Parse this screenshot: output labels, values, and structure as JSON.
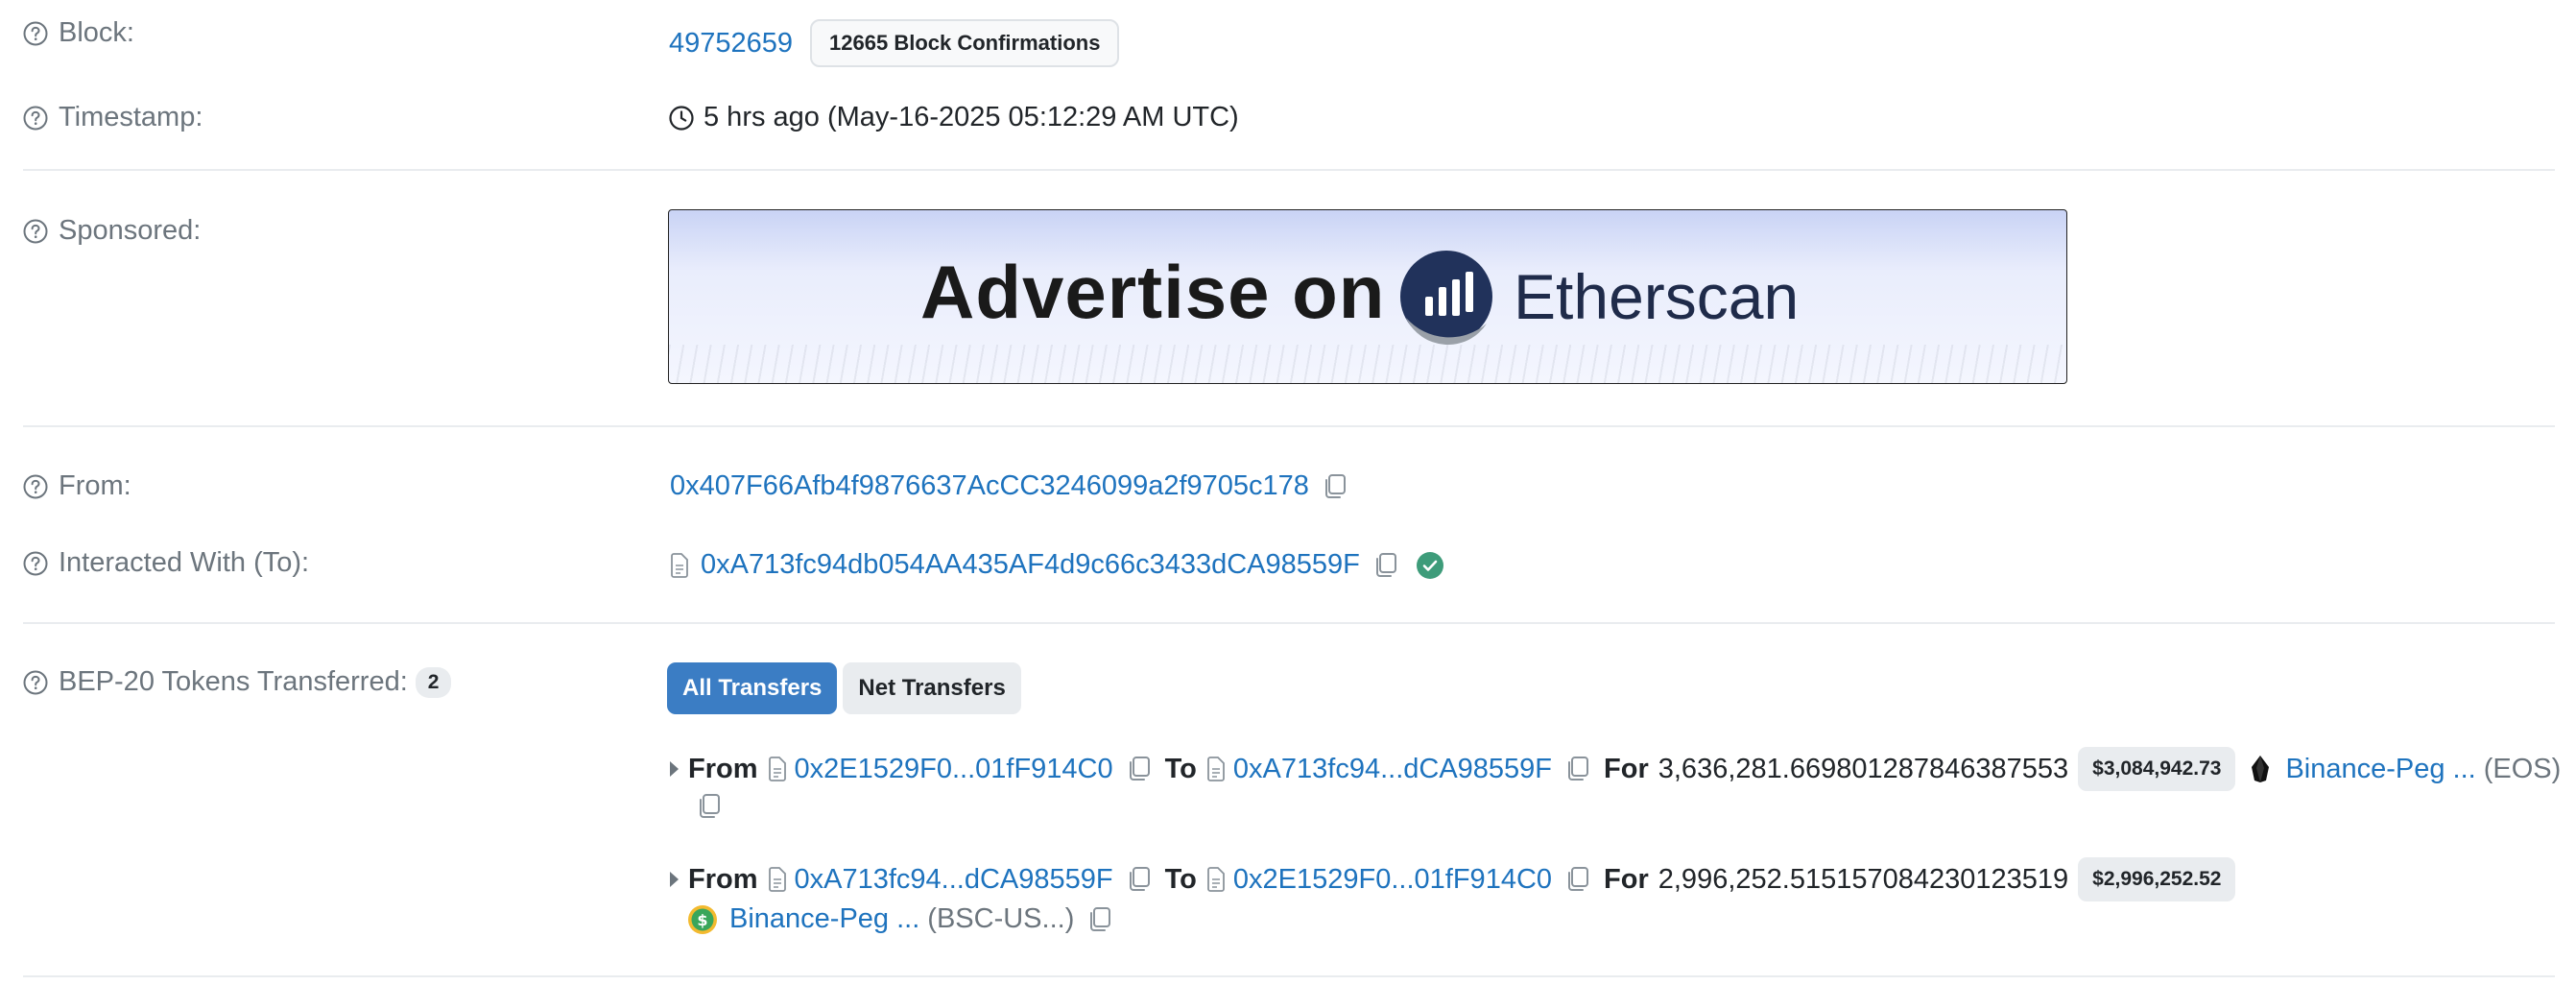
{
  "rows": {
    "block": {
      "label": "Block:",
      "value": "49752659",
      "confirmations": "12665 Block Confirmations"
    },
    "timestamp": {
      "label": "Timestamp:",
      "value": "5 hrs ago (May-16-2025 05:12:29 AM UTC)"
    },
    "sponsored": {
      "label": "Sponsored:",
      "ad_text": "Advertise on",
      "ad_brand": "Etherscan"
    },
    "from": {
      "label": "From:",
      "address": "0x407F66Afb4f9876637AcCC3246099a2f9705c178"
    },
    "to": {
      "label": "Interacted With (To):",
      "address": "0xA713fc94db054AA435AF4d9c66c3433dCA98559F"
    },
    "tokens": {
      "label": "BEP-20 Tokens Transferred:",
      "count": "2",
      "tabs": [
        "All Transfers",
        "Net Transfers"
      ],
      "transfers": [
        {
          "from_label": "From",
          "from_addr": "0x2E1529F0...01fF914C0",
          "to_label": "To",
          "to_addr": "0xA713fc94...dCA98559F",
          "for_label": "For",
          "amount": "3,636,281.669801287846387553",
          "usd": "$3,084,942.73",
          "token_name": "Binance-Peg ...",
          "token_symbol": "(EOS)"
        },
        {
          "from_label": "From",
          "from_addr": "0xA713fc94...dCA98559F",
          "to_label": "To",
          "to_addr": "0x2E1529F0...01fF914C0",
          "for_label": "For",
          "amount": "2,996,252.515157084230123519",
          "usd": "$2,996,252.52",
          "token_name": "Binance-Peg ...",
          "token_symbol": "(BSC-US...)"
        }
      ]
    }
  },
  "colors": {
    "link": "#1e73be",
    "label": "#6c757d",
    "primary_button": "#3b7dc4",
    "verified": "#3e9c7a"
  },
  "icons": {
    "help": "question-circle-icon",
    "clock": "clock-icon",
    "copy": "copy-icon",
    "contract": "file-icon",
    "verified": "check-circle-icon",
    "eos": "eos-token-icon",
    "usd": "usd-token-icon"
  }
}
